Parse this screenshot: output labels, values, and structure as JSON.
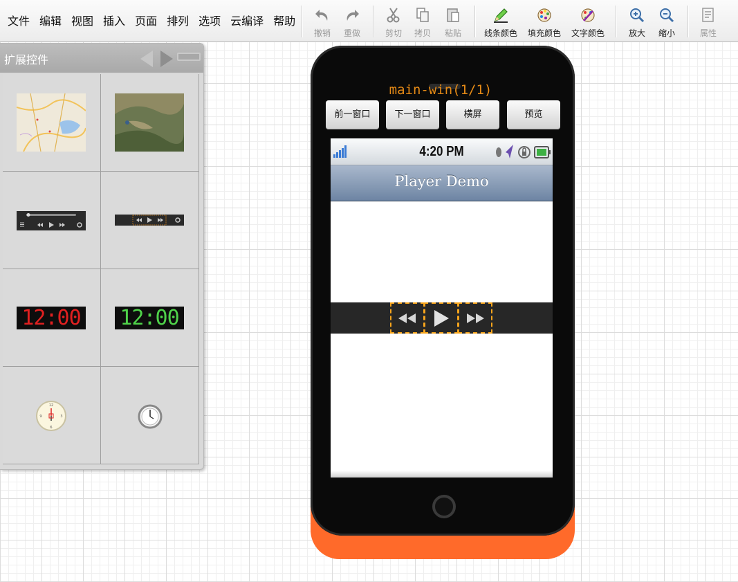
{
  "menu": [
    "文件",
    "编辑",
    "视图",
    "插入",
    "页面",
    "排列",
    "选项",
    "云编译",
    "帮助"
  ],
  "toolbar": {
    "undo": "撤销",
    "redo": "重做",
    "cut": "剪切",
    "copy": "拷贝",
    "paste": "粘贴",
    "line_color": "线条颜色",
    "fill_color": "填充颜色",
    "text_color": "文字颜色",
    "zoom_in": "放大",
    "zoom_out": "缩小",
    "properties": "属性"
  },
  "panel": {
    "title": "扩展控件",
    "clock_red_text": "12:00",
    "clock_green_text": "12:00"
  },
  "phone": {
    "window_title": "main-win(1/1)",
    "buttons": {
      "prev_window": "前一窗口",
      "next_window": "下一窗口",
      "landscape": "横屏",
      "preview": "预览"
    },
    "status_time": "4:20 PM",
    "nav_title": "Player Demo"
  },
  "colors": {
    "phone_accent": "#ff6a2a",
    "selection_dashed": "#f7a51c",
    "window_title": "#e58a16",
    "nav_bar": "#7d91ad"
  }
}
